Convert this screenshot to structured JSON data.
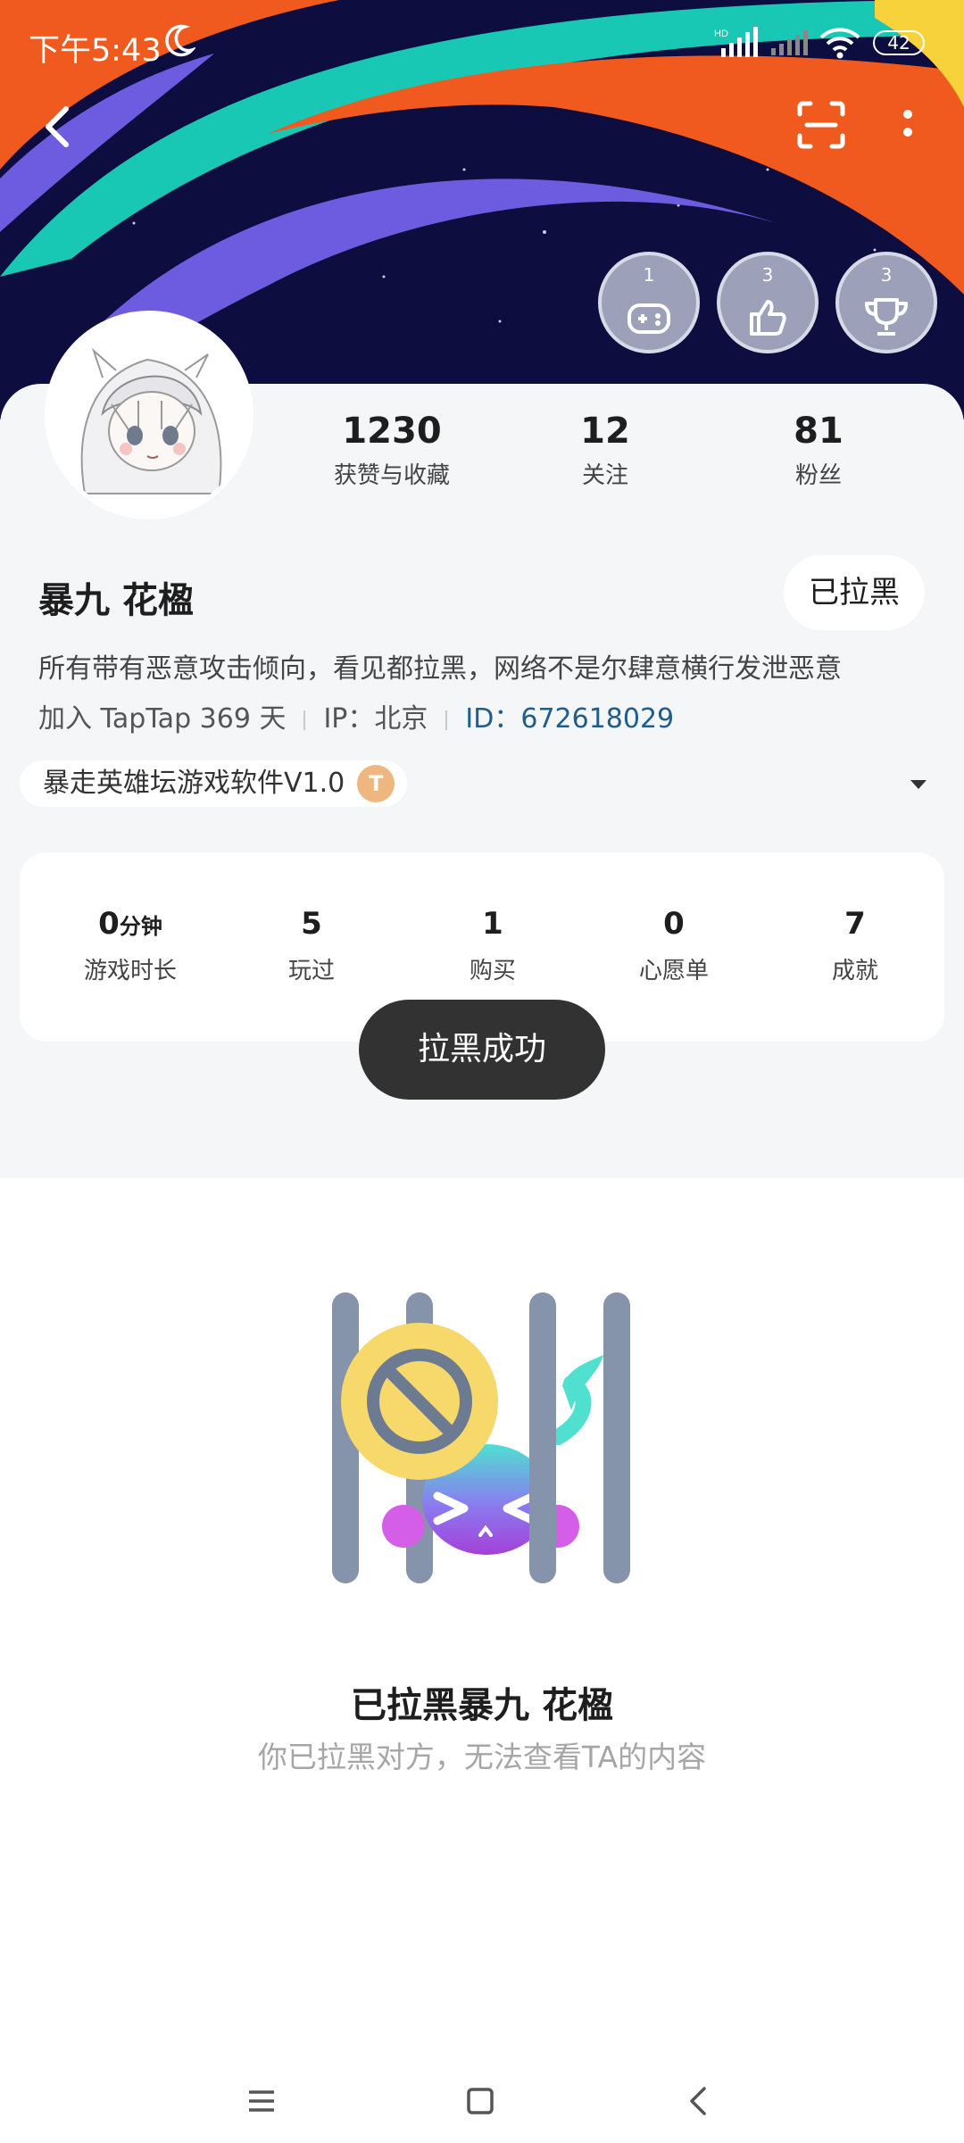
{
  "status_bar": {
    "time": "下午5:43",
    "network_label": "HD",
    "battery": "42"
  },
  "badges": [
    {
      "count": "1",
      "icon": "gamepad-icon"
    },
    {
      "count": "3",
      "icon": "thumbs-up-icon"
    },
    {
      "count": "3",
      "icon": "trophy-icon"
    }
  ],
  "profile": {
    "stats": [
      {
        "value": "1230",
        "label": "获赞与收藏"
      },
      {
        "value": "12",
        "label": "关注"
      },
      {
        "value": "81",
        "label": "粉丝"
      }
    ],
    "username": "暴九 花楹",
    "blocked_button_label": "已拉黑",
    "bio": "所有带有恶意攻击倾向，看见都拉黑，网络不是尔肆意横行发泄恶意",
    "joined": "加入 TapTap 369 天",
    "ip": "IP：北京",
    "id": "ID：672618029",
    "game_tag": "暴走英雄坛游戏软件V1.0",
    "game_tag_icon_letter": "T"
  },
  "play_stats": [
    {
      "value": "0",
      "unit": "分钟",
      "label": "游戏时长"
    },
    {
      "value": "5",
      "unit": "",
      "label": "玩过"
    },
    {
      "value": "1",
      "unit": "",
      "label": "购买"
    },
    {
      "value": "0",
      "unit": "",
      "label": "心愿单"
    },
    {
      "value": "7",
      "unit": "",
      "label": "成就"
    }
  ],
  "toast": "拉黑成功",
  "empty_state": {
    "title": "已拉黑暴九 花楹",
    "subtitle": "你已拉黑对方，无法查看TA的内容"
  },
  "colors": {
    "banner_bg": "#0e0d3f",
    "stripe_teal": "#18c8b4",
    "stripe_orange": "#f05a1e",
    "stripe_purple": "#6e5ce0",
    "stripe_yellow": "#f7d23a",
    "id_link": "#1f5d8c",
    "card_bg": "#f5f6f8",
    "toast_bg": "#323232"
  }
}
